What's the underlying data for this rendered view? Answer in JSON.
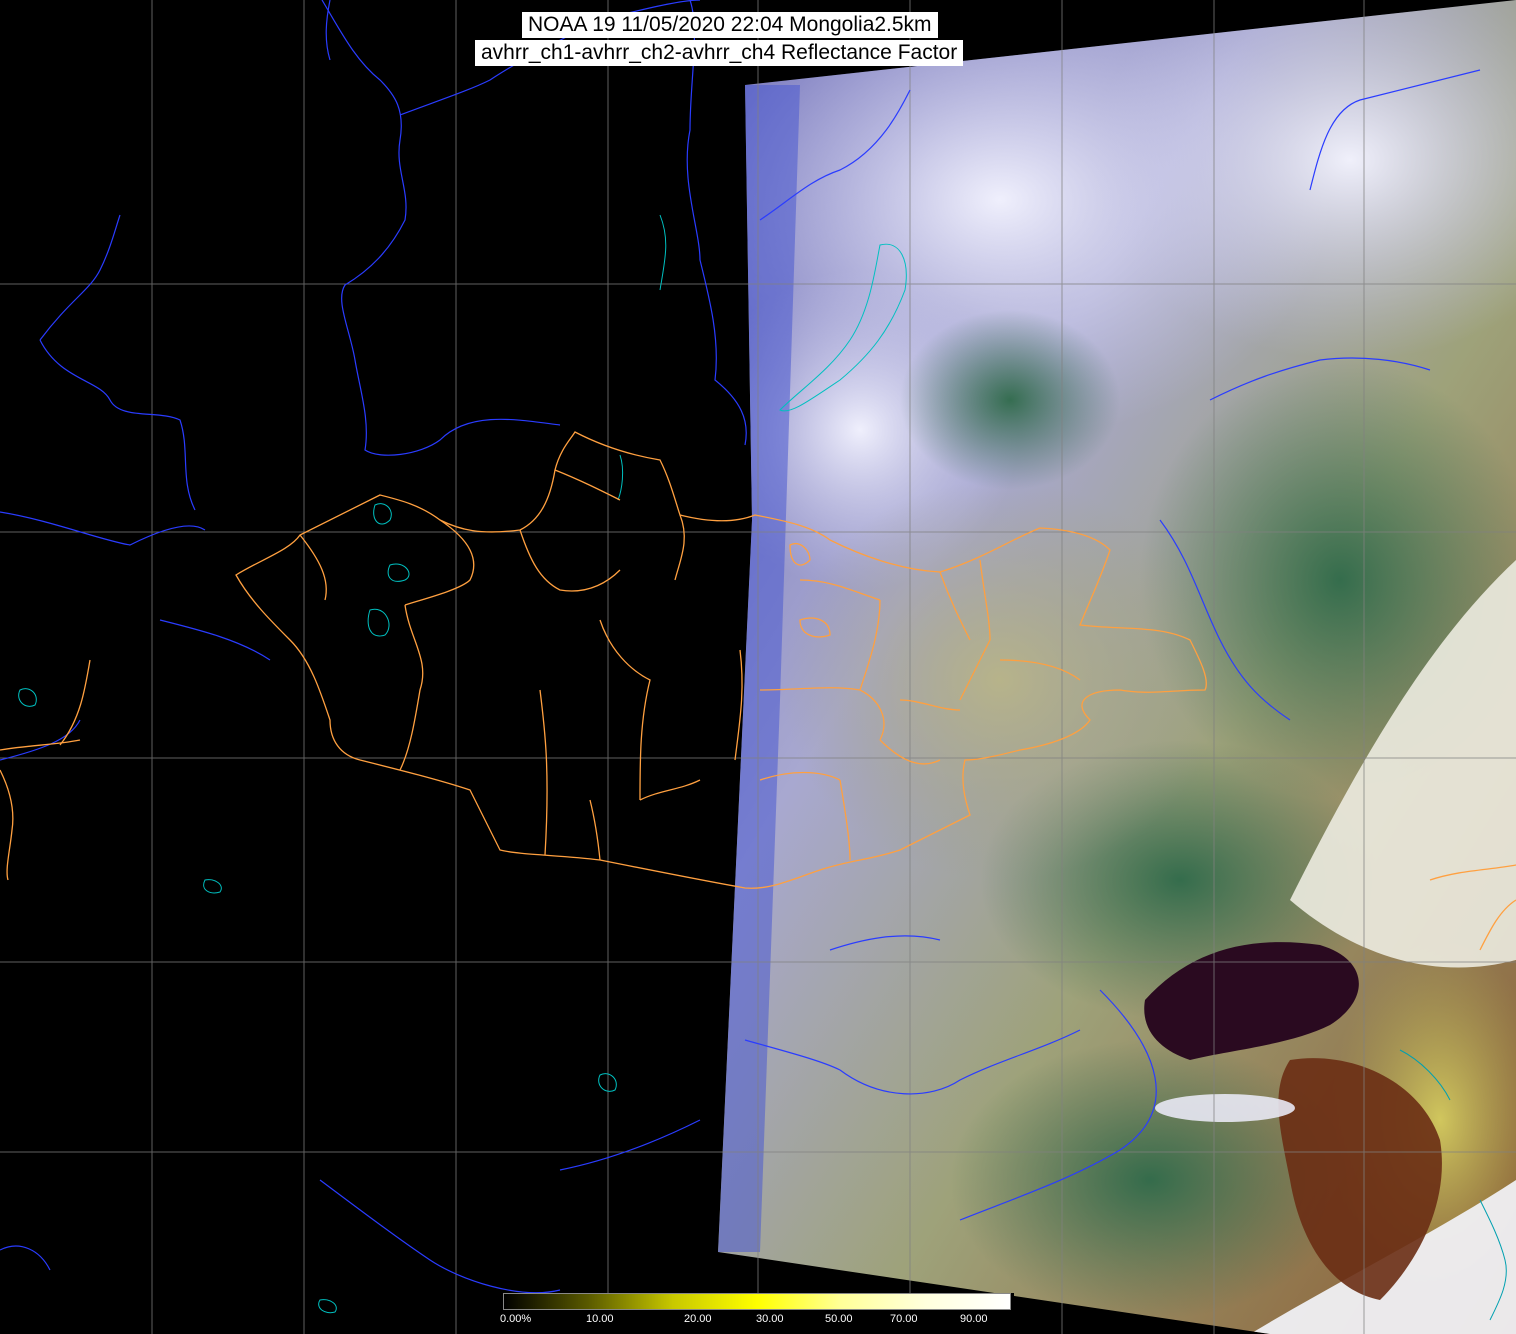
{
  "title": {
    "line1": "NOAA 19 11/05/2020 22:04 Mongolia2.5km",
    "line2": "avhrr_ch1-avhrr_ch2-avhrr_ch4 Reflectance Factor"
  },
  "colorbar": {
    "ticks": [
      "0.00%",
      "10.00",
      "20.00",
      "30.00",
      "50.00",
      "70.00",
      "90.00"
    ],
    "colors": [
      "#000000",
      "#5a5a00",
      "#c8c800",
      "#ffff00",
      "#ffff99",
      "#ffffdd",
      "#ffffff"
    ]
  },
  "colors": {
    "background": "#000000",
    "graticule": "#808080",
    "rivers": "#2a3cff",
    "lakes": "#00c0c0",
    "admin_borders": "#ffa040",
    "cloud": "#d8d8f0",
    "land_green": "#3c7050",
    "sea_dark": "#2a0a20"
  },
  "layers": [
    "graticule",
    "rivers",
    "lakes",
    "admin-borders",
    "satellite-swath",
    "colorbar"
  ]
}
